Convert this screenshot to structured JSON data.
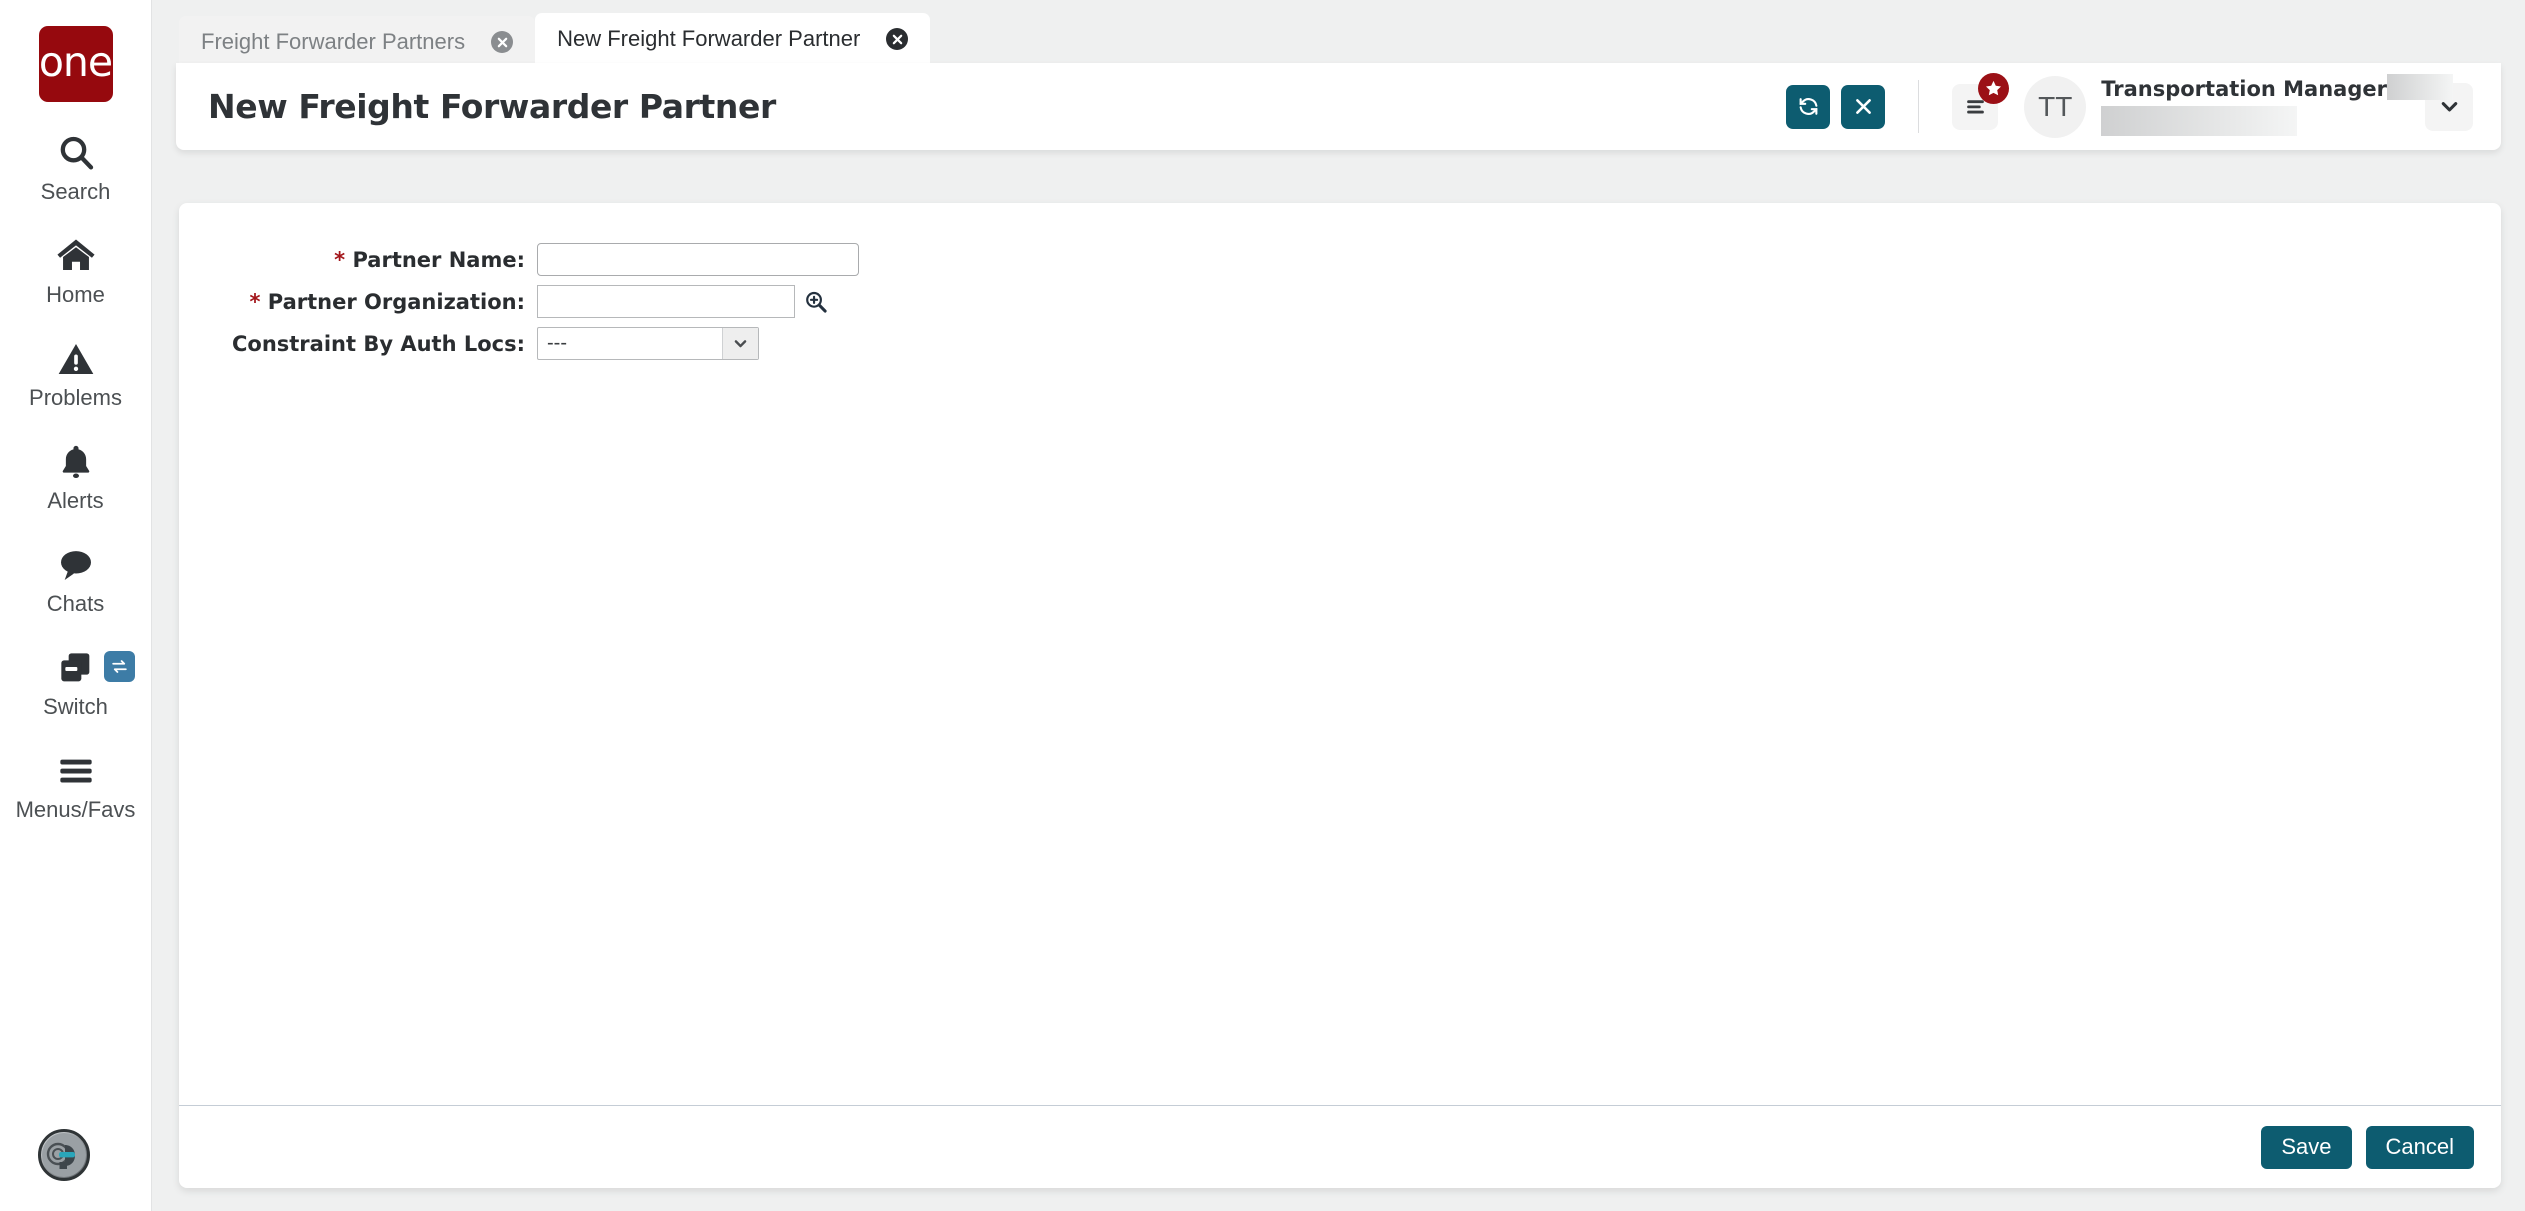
{
  "brand": {
    "logo_text": "one",
    "logo_color": "#96090e"
  },
  "theme": {
    "accent": "#0d5c70",
    "badge_red": "#9b1016",
    "required_star": "#a3161b",
    "switch_badge_blue": "#3d7ca6"
  },
  "sidebar": {
    "items": [
      {
        "label": "Search",
        "icon": "search-icon"
      },
      {
        "label": "Home",
        "icon": "home-icon"
      },
      {
        "label": "Problems",
        "icon": "warning-triangle-icon"
      },
      {
        "label": "Alerts",
        "icon": "bell-icon"
      },
      {
        "label": "Chats",
        "icon": "chat-bubble-icon"
      },
      {
        "label": "Switch",
        "icon": "switch-cards-icon"
      },
      {
        "label": "Menus/Favs",
        "icon": "hamburger-icon"
      }
    ],
    "assistant_avatar": "robot-assistant-icon"
  },
  "tabs": [
    {
      "label": "Freight Forwarder Partners",
      "active": false
    },
    {
      "label": "New Freight Forwarder Partner",
      "active": true
    }
  ],
  "header": {
    "title": "New Freight Forwarder Partner",
    "refresh_button": "refresh-icon",
    "close_button": "close-icon",
    "menu_favorites_button": "list-icon",
    "favorites_badge": "star-icon",
    "avatar_initials": "TT",
    "user_role": "Transportation Manager",
    "user_name": "",
    "dropdown_button": "chevron-down-icon"
  },
  "form": {
    "fields": [
      {
        "label": "Partner Name:",
        "required": true,
        "value": "",
        "placeholder": "",
        "type": "text"
      },
      {
        "label": "Partner Organization:",
        "required": true,
        "value": "",
        "placeholder": "",
        "type": "text-lookup",
        "lookup_icon": "magnifier-plus-icon"
      },
      {
        "label": "Constraint By Auth Locs:",
        "required": false,
        "value": "---",
        "type": "select",
        "options": [
          "---"
        ]
      }
    ]
  },
  "footer": {
    "save_label": "Save",
    "cancel_label": "Cancel"
  }
}
